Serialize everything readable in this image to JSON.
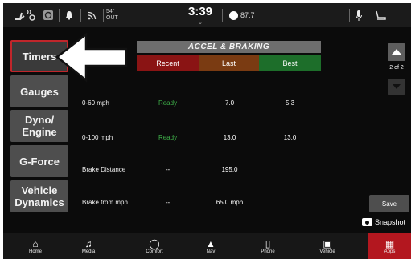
{
  "status_bar": {
    "temperature": "54°",
    "temperature_label": "OUT",
    "clock": "3:39",
    "fuel_reading": "87.7"
  },
  "nav": {
    "items": [
      {
        "label": "Timers",
        "active": true
      },
      {
        "label": "Gauges"
      },
      {
        "label": "Dyno/ Engine"
      },
      {
        "label": "G-Force"
      },
      {
        "label": "Vehicle Dynamics"
      }
    ]
  },
  "timers": {
    "title": "ACCEL & BRAKING",
    "columns": [
      {
        "label": "Recent",
        "color": "#8a1414"
      },
      {
        "label": "Last",
        "color": "#7a3b12"
      },
      {
        "label": "Best",
        "color": "#1d6e2a"
      }
    ],
    "rows": [
      {
        "label": "0-60 mph",
        "recent": "Ready",
        "last": "7.0",
        "best": "5.3"
      },
      {
        "label": "0-100 mph",
        "recent": "Ready",
        "last": "13.0",
        "best": "13.0"
      },
      {
        "label": "Brake Distance",
        "recent": "--",
        "last": "195.0",
        "best": ""
      },
      {
        "label": "Brake from mph",
        "recent": "--",
        "last": "65.0 mph",
        "best": ""
      }
    ]
  },
  "pager": {
    "indicator": "2 of 2"
  },
  "actions": {
    "save": "Save",
    "snapshot": "Snapshot"
  },
  "bottom_nav": [
    {
      "label": "Home",
      "icon": "home-icon"
    },
    {
      "label": "Media",
      "icon": "music-note-icon"
    },
    {
      "label": "Comfort",
      "icon": "climate-icon"
    },
    {
      "label": "Nav",
      "icon": "navigation-arrow-icon"
    },
    {
      "label": "Phone",
      "icon": "phone-icon"
    },
    {
      "label": "Vehicle",
      "icon": "car-icon"
    },
    {
      "label": "Apps",
      "icon": "apps-grid-icon",
      "active": true
    }
  ]
}
